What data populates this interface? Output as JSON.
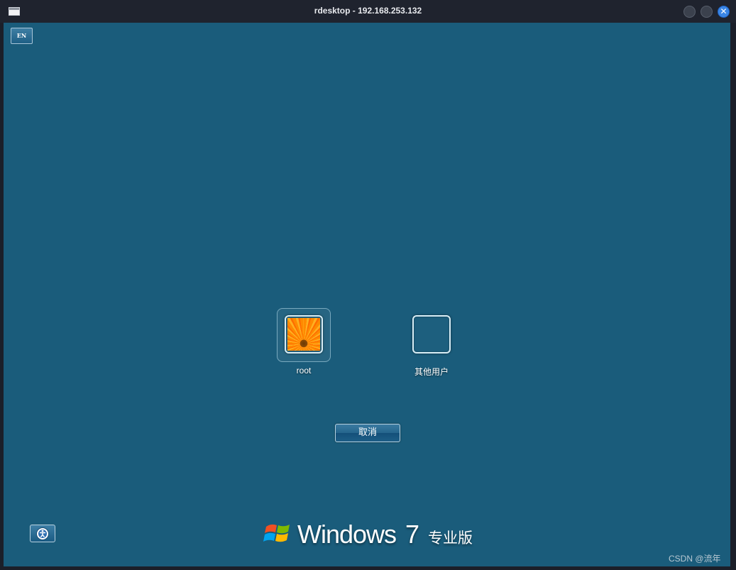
{
  "window": {
    "title": "rdesktop - 192.168.253.132",
    "close_glyph": "✕"
  },
  "desktop": {
    "language_button": "EN",
    "users": [
      {
        "name": "root",
        "picture": "flower"
      },
      {
        "name": "其他用户",
        "picture": "none"
      }
    ],
    "cancel_label": "取消",
    "brand": {
      "word": "Windows",
      "version": "7",
      "edition": "专业版"
    },
    "ease_of_access_icon": "ease-of-access-icon"
  },
  "watermark": "CSDN @流年"
}
